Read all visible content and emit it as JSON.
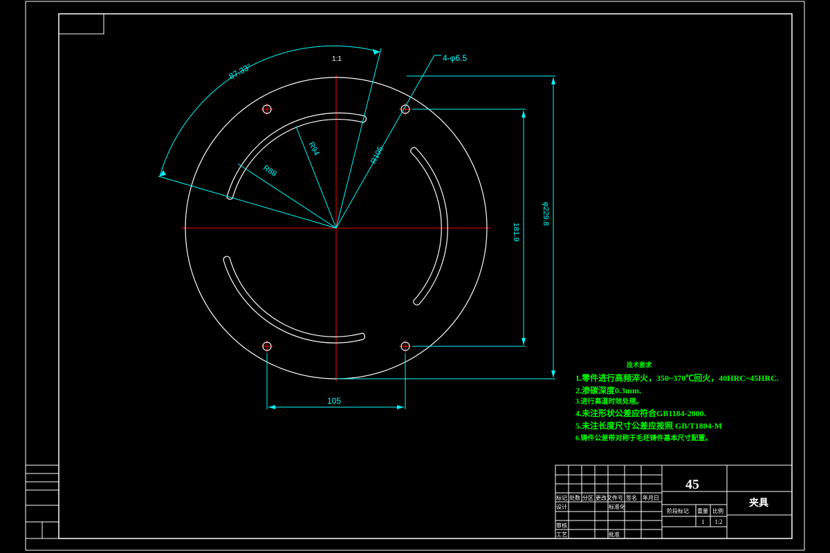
{
  "dimensions": {
    "angle": "87.33°",
    "slot_width_label": "1:1",
    "holes": "4-φ6.5",
    "radius_outer_slot": "R94",
    "radius_inner_slot": "R88",
    "radius_holes": "R105",
    "vertical_inner": "181.9",
    "diameter": "φ229.8",
    "horizontal": "105"
  },
  "notes": {
    "heading": "技术要求",
    "items": [
      "1.零件进行高频淬火，350~370℃回火，40HRC~45HRC.",
      "2.渗碳深度0.3mm.",
      "3.进行高温时效处理。",
      "4.未注形状公差应符合GB1184-2000.",
      "5.未注长度尺寸公差应按照 GB/T1804-M",
      "6.铸件公差带对称于毛坯铸件基本尺寸配置。"
    ]
  },
  "title_block": {
    "material": "45",
    "part_name": "夹具",
    "headers": [
      "标记",
      "处数",
      "分区",
      "更改文件号",
      "签名",
      "年月日"
    ],
    "design": "设计",
    "standardize": "标准化",
    "review": "审核",
    "process": "工艺",
    "approve": "批准",
    "stage_mark": "阶段标记",
    "weight": "重量",
    "scale_label": "比例",
    "quantity": "1",
    "scale": "1:2"
  },
  "colors": {
    "outline": "#ffffff",
    "dimension": "#00ffff",
    "centerline": "#ff0000",
    "notes": "#00ff00",
    "background": "#000000"
  }
}
